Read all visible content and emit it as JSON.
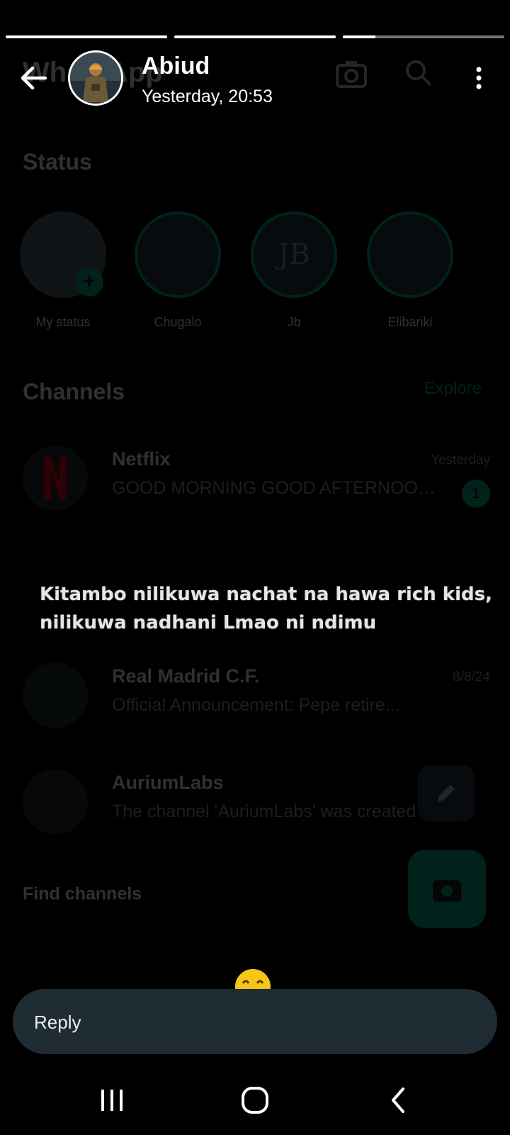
{
  "background": {
    "title": "WhatsApp",
    "status_heading": "Status",
    "statuses": [
      {
        "name": "My status"
      },
      {
        "name": "Chugalo"
      },
      {
        "name": "Jb",
        "initials": "JB"
      },
      {
        "name": "Elibariki"
      }
    ],
    "channels_heading": "Channels",
    "explore_label": "Explore",
    "channels": [
      {
        "name": "Netflix",
        "time": "Yesterday",
        "message": "GOOD MORNING GOOD AFTERNOON...",
        "badge": "1"
      },
      {
        "name": "Real Madrid C.F.",
        "time": "8/8/24",
        "message": "Official Announcement: Pepe retire..."
      },
      {
        "name": "AuriumLabs",
        "time": "",
        "message": "The channel 'AuriumLabs' was created"
      }
    ],
    "find_channels": "Find channels"
  },
  "story": {
    "progress": [
      1.0,
      1.0,
      0.2
    ],
    "contact_name": "Abiud",
    "timestamp": "Yesterday, 20:53",
    "text": "Kitambo nilikuwa nachat na hawa rich kids, nilikuwa nadhani Lmao ni ndimu",
    "reply_placeholder": "Reply"
  },
  "icons": {
    "back": "arrow-left-icon",
    "more": "more-vertical-icon",
    "emoji": "grinning-face-icon",
    "nav_recents": "recents-icon",
    "nav_home": "home-icon",
    "nav_back": "nav-back-icon"
  },
  "colors": {
    "accent": "#00a884",
    "reply_bg": "#1f2c34"
  }
}
